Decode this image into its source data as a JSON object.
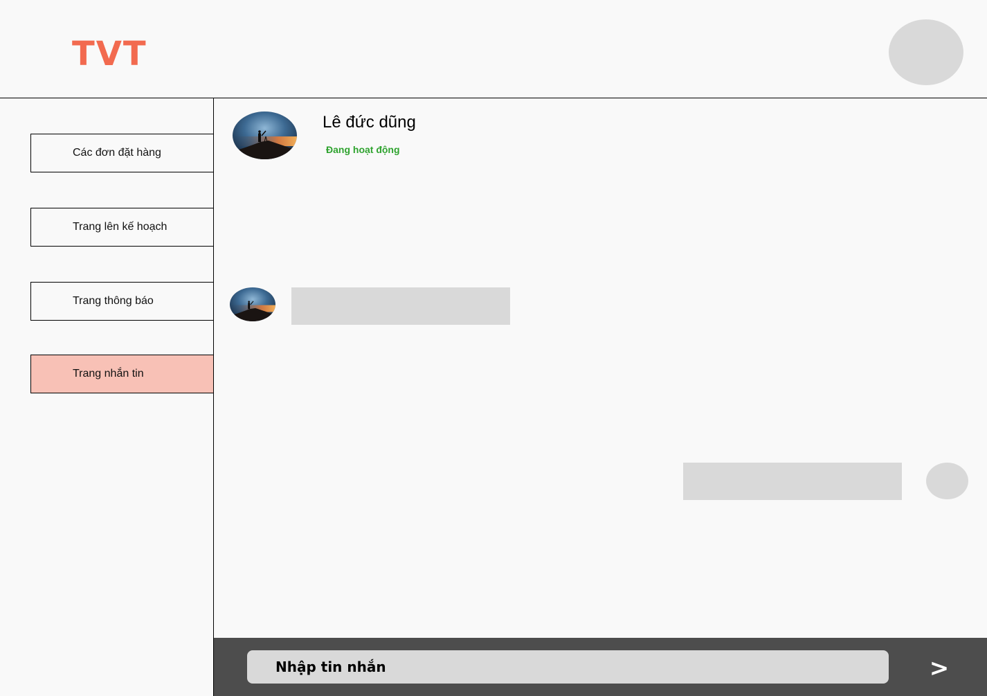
{
  "header": {
    "logo": "TVT"
  },
  "sidebar": {
    "items": [
      {
        "label": "Các đơn đặt hàng",
        "active": false
      },
      {
        "label": "Trang lên kế hoạch",
        "active": false
      },
      {
        "label": "Trang thông báo",
        "active": false
      },
      {
        "label": "Trang nhắn tin",
        "active": true
      }
    ]
  },
  "chat": {
    "contact_name": "Lê đức dũng",
    "contact_status": "Đang hoạt động"
  },
  "composer": {
    "placeholder": "Nhập tin nhắn",
    "send_label": ">"
  },
  "colors": {
    "logo": "#f26a4f",
    "active_nav": "#f8c1b6",
    "status": "#2fa32f",
    "composer_bar": "#4d4d4d",
    "placeholder_gray": "#d9d9d9"
  }
}
